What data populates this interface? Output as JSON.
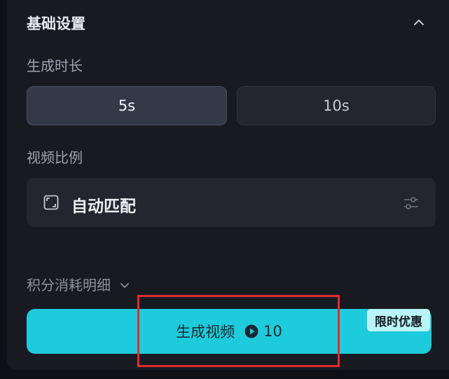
{
  "basic_settings": {
    "title": "基础设置",
    "collapse_icon": "chevron-up-icon"
  },
  "duration": {
    "label": "生成时长",
    "options": [
      "5s",
      "10s"
    ],
    "selected": "5s"
  },
  "aspect_ratio": {
    "label": "视频比例",
    "value": "自动匹配",
    "icon": "aspect-ratio-icon",
    "settings_icon": "sliders-icon"
  },
  "credits": {
    "detail_label": "积分消耗明细",
    "toggle_icon": "chevron-down-icon"
  },
  "generate": {
    "label": "生成视频",
    "cost": "10",
    "cost_icon": "coin-icon",
    "promo_badge": "限时优惠"
  },
  "colors": {
    "accent": "#1ecbdc",
    "panel": "#181a22",
    "highlight": "#e22b2b"
  }
}
